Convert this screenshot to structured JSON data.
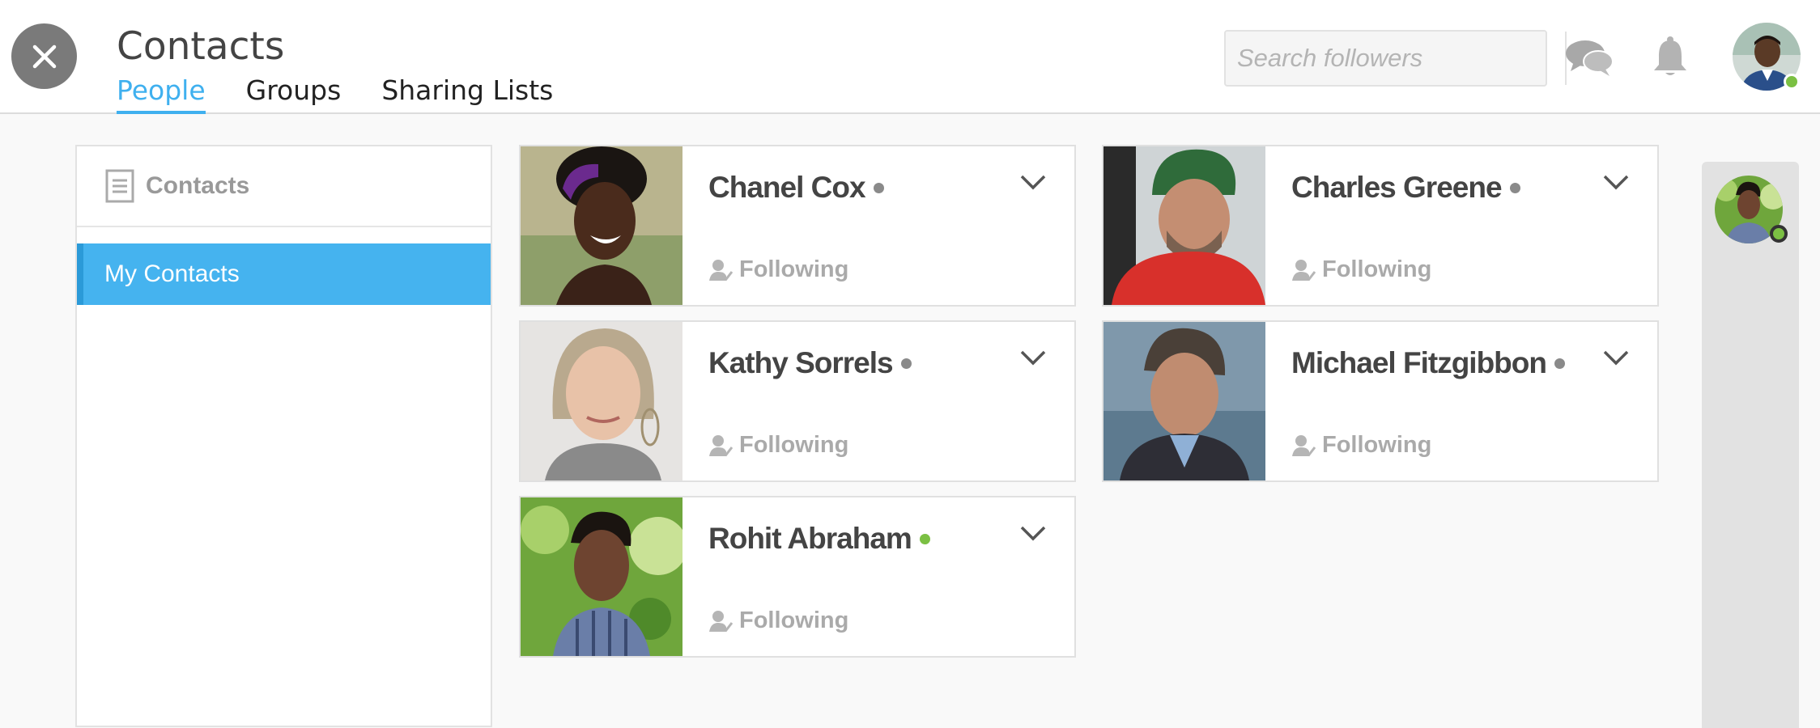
{
  "header": {
    "title": "Contacts",
    "tabs": [
      {
        "label": "People",
        "active": true
      },
      {
        "label": "Groups",
        "active": false
      },
      {
        "label": "Sharing Lists",
        "active": false
      }
    ],
    "search": {
      "placeholder": "Search followers",
      "value": ""
    },
    "icons": [
      "close-icon",
      "search-icon",
      "chat-icon",
      "bell-icon"
    ]
  },
  "sidebar": {
    "header_label": "Contacts",
    "items": [
      {
        "label": "My Contacts",
        "selected": true
      }
    ]
  },
  "contacts": [
    {
      "name": "Chanel Cox",
      "status": "Following",
      "presence_color": "#8a8a8a"
    },
    {
      "name": "Charles Greene",
      "status": "Following",
      "presence_color": "#8a8a8a"
    },
    {
      "name": "Kathy Sorrels",
      "status": "Following",
      "presence_color": "#8a8a8a"
    },
    {
      "name": "Michael Fitzgibbon",
      "status": "Following",
      "presence_color": "#8a8a8a"
    },
    {
      "name": "Rohit Abraham",
      "status": "Following",
      "presence_color": "#7bc043"
    }
  ],
  "colors": {
    "accent": "#3fb0ef",
    "online": "#7bc043",
    "offline": "#8a8a8a"
  }
}
